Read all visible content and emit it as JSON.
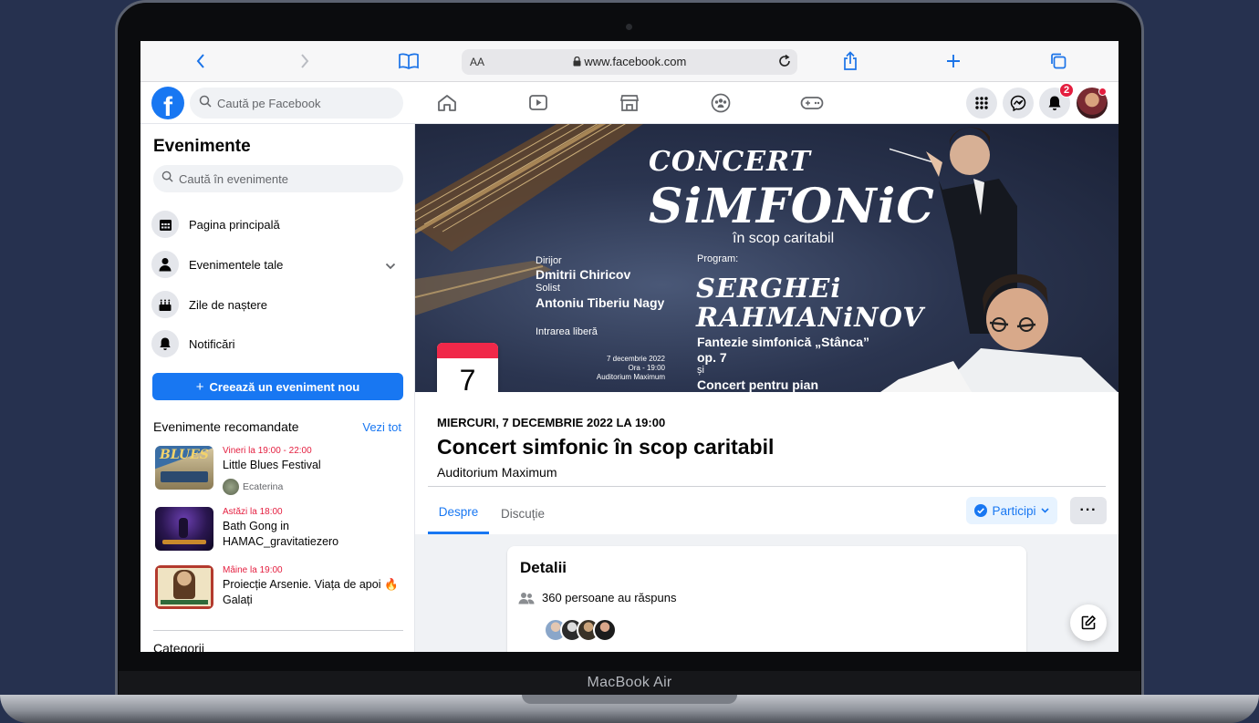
{
  "device": {
    "label": "MacBook Air"
  },
  "browser": {
    "text_size_label": "AA",
    "url": "www.facebook.com",
    "icons": [
      "back-icon",
      "forward-icon",
      "bookmarks-icon",
      "lock-icon",
      "reload-icon",
      "share-icon",
      "new-tab-icon",
      "tabs-icon"
    ]
  },
  "topnav": {
    "logo": "f",
    "search_placeholder": "Caută pe Facebook",
    "nav_icons": [
      "home-icon",
      "watch-icon",
      "marketplace-icon",
      "groups-icon",
      "gaming-icon"
    ],
    "notification_count": "2",
    "accent": "#1877f2"
  },
  "sidebar": {
    "title": "Evenimente",
    "search_placeholder": "Caută în evenimente",
    "items": [
      {
        "label": "Pagina principală",
        "icon": "calendar-icon"
      },
      {
        "label": "Evenimentele tale",
        "icon": "person-icon"
      },
      {
        "label": "Zile de naștere",
        "icon": "cake-icon"
      },
      {
        "label": "Notificări",
        "icon": "bell-icon"
      }
    ],
    "create_label": "Creează un eveniment nou",
    "recommended_title": "Evenimente recomandate",
    "see_all": "Vezi tot",
    "recommended": [
      {
        "when": "Vineri la 19:00 - 22:00",
        "name": "Little Blues Festival",
        "host": "Ecaterina",
        "thumb_text": "BLUES"
      },
      {
        "when": "Astăzi la 18:00",
        "name": "Bath Gong in HAMAC_gravitatiezero"
      },
      {
        "when": "Mâine la 19:00",
        "name": "Proiecție Arsenie. Viața de apoi 🔥 Galați"
      }
    ],
    "categories_label": "Categorii"
  },
  "cover": {
    "concert": "CONCERT",
    "simfonic": "SiMFONiC",
    "subtitle": "în scop caritabil",
    "dirijor_label": "Dirijor",
    "dirijor": "Dmitrii Chiricov",
    "solist_label": "Solist",
    "solist": "Antoniu Tiberiu Nagy",
    "entry": "Intrarea liberă",
    "date_line": "7 decembrie 2022",
    "time_line": "Ora - 19:00",
    "venue_line": "Auditorium Maximum",
    "program_label": "Program:",
    "composer_1": "SERGHEi",
    "composer_2": "RAHMANiNOV",
    "piece_1": "Fantezie simfonică „Stânca”",
    "piece_1b": "op. 7",
    "conj": "și",
    "piece_2": "Concert pentru pian"
  },
  "event": {
    "day": "7",
    "date_text": "MIERCURI, 7 DECEMBRIE 2022 LA 19:00",
    "title": "Concert simfonic în scop caritabil",
    "place": "Auditorium Maximum",
    "tabs": [
      "Despre",
      "Discuție"
    ],
    "going_label": "Participi",
    "more_label": "···"
  },
  "details": {
    "title": "Detalii",
    "responded": "360 persoane au răspuns"
  }
}
